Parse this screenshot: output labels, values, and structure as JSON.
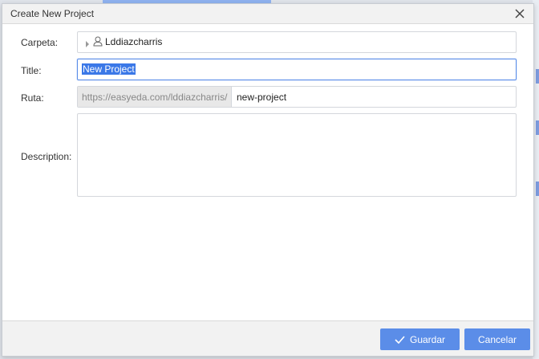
{
  "dialog": {
    "title": "Create New Project",
    "close_icon": "close-icon"
  },
  "form": {
    "carpeta_label": "Carpeta:",
    "carpeta_value": "Lddiazcharris",
    "title_label": "Title:",
    "title_value": "New Project",
    "ruta_label": "Ruta:",
    "ruta_prefix": "https://easyeda.com/lddiazcharris/",
    "ruta_value": "new-project",
    "description_label": "Description:",
    "description_value": ""
  },
  "footer": {
    "save_label": "Guardar",
    "cancel_label": "Cancelar"
  },
  "colors": {
    "accent": "#5b8de8",
    "selection": "#3b78e7",
    "titlebar_bg": "#f2f2f2"
  },
  "icons": [
    "close-icon",
    "tree-expand-icon",
    "user-icon",
    "check-icon"
  ]
}
